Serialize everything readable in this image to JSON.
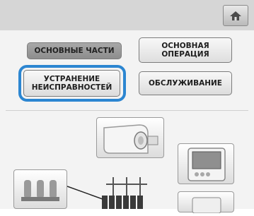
{
  "header": {
    "home_icon": "home-icon"
  },
  "menu": {
    "parts_label": "ОСНОВНЫЕ ЧАСТИ",
    "basic_operation_label": "ОСНОВНАЯ\nОПЕРАЦИЯ",
    "troubleshooting_label": "УСТРАНЕНИЕ\nНЕИСПРАВНОСТЕЙ",
    "maintenance_label": "ОБСЛУЖИВАНИЕ",
    "selected": "troubleshooting"
  },
  "colors": {
    "highlight": "#2c86d1",
    "header_bg": "#d6d6d6",
    "panel_bg": "#f3f3f3"
  },
  "thumbnails": [
    {
      "icon": "embroidery-head-icon"
    },
    {
      "icon": "lcd-panel-icon"
    },
    {
      "icon": "thread-spools-icon"
    },
    {
      "icon": "thread-stand-icon"
    },
    {
      "icon": "machine-part-icon"
    }
  ]
}
